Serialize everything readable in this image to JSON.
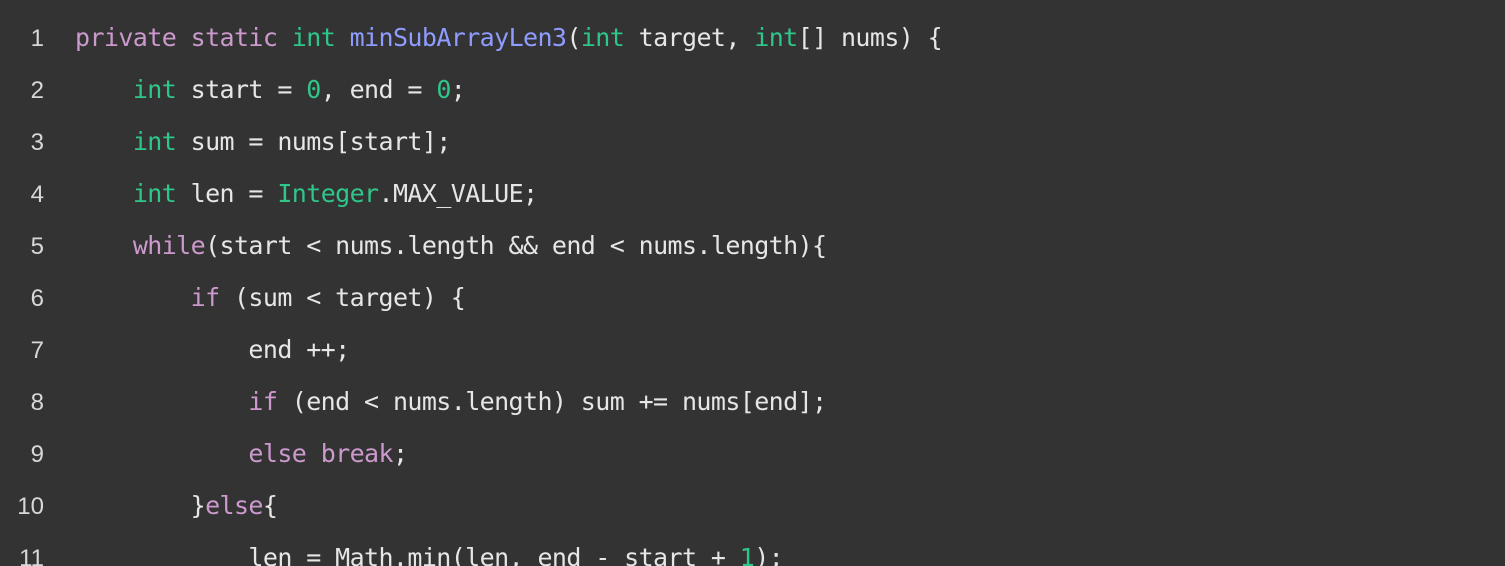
{
  "editor": {
    "lines": [
      {
        "number": "1",
        "tokens": [
          {
            "t": "private",
            "k": "kw-purple"
          },
          {
            "t": " ",
            "k": "plain"
          },
          {
            "t": "static",
            "k": "kw-purple"
          },
          {
            "t": " ",
            "k": "plain"
          },
          {
            "t": "int",
            "k": "kw-green"
          },
          {
            "t": " ",
            "k": "plain"
          },
          {
            "t": "minSubArrayLen3",
            "k": "fn-blue"
          },
          {
            "t": "(",
            "k": "plain"
          },
          {
            "t": "int",
            "k": "kw-green"
          },
          {
            "t": " target, ",
            "k": "plain"
          },
          {
            "t": "int",
            "k": "kw-green"
          },
          {
            "t": "[] nums) {",
            "k": "plain"
          }
        ]
      },
      {
        "number": "2",
        "tokens": [
          {
            "t": "    ",
            "k": "plain"
          },
          {
            "t": "int",
            "k": "kw-green"
          },
          {
            "t": " start = ",
            "k": "plain"
          },
          {
            "t": "0",
            "k": "num-green"
          },
          {
            "t": ", end = ",
            "k": "plain"
          },
          {
            "t": "0",
            "k": "num-green"
          },
          {
            "t": ";",
            "k": "plain"
          }
        ]
      },
      {
        "number": "3",
        "tokens": [
          {
            "t": "    ",
            "k": "plain"
          },
          {
            "t": "int",
            "k": "kw-green"
          },
          {
            "t": " sum = nums[start];",
            "k": "plain"
          }
        ]
      },
      {
        "number": "4",
        "tokens": [
          {
            "t": "    ",
            "k": "plain"
          },
          {
            "t": "int",
            "k": "kw-green"
          },
          {
            "t": " len = ",
            "k": "plain"
          },
          {
            "t": "Integer",
            "k": "type-green"
          },
          {
            "t": ".MAX_VALUE;",
            "k": "plain"
          }
        ]
      },
      {
        "number": "5",
        "tokens": [
          {
            "t": "    ",
            "k": "plain"
          },
          {
            "t": "while",
            "k": "kw-purple"
          },
          {
            "t": "(start < nums.length && end < nums.length){",
            "k": "plain"
          }
        ]
      },
      {
        "number": "6",
        "tokens": [
          {
            "t": "        ",
            "k": "plain"
          },
          {
            "t": "if",
            "k": "kw-purple"
          },
          {
            "t": " (sum < target) {",
            "k": "plain"
          }
        ]
      },
      {
        "number": "7",
        "tokens": [
          {
            "t": "            end ++;",
            "k": "plain"
          }
        ]
      },
      {
        "number": "8",
        "tokens": [
          {
            "t": "            ",
            "k": "plain"
          },
          {
            "t": "if",
            "k": "kw-purple"
          },
          {
            "t": " (end < nums.length) sum += nums[end];",
            "k": "plain"
          }
        ]
      },
      {
        "number": "9",
        "tokens": [
          {
            "t": "            ",
            "k": "plain"
          },
          {
            "t": "else",
            "k": "kw-purple"
          },
          {
            "t": " ",
            "k": "plain"
          },
          {
            "t": "break",
            "k": "kw-purple"
          },
          {
            "t": ";",
            "k": "plain"
          }
        ]
      },
      {
        "number": "10",
        "tokens": [
          {
            "t": "        }",
            "k": "plain"
          },
          {
            "t": "else",
            "k": "kw-purple"
          },
          {
            "t": "{",
            "k": "plain"
          }
        ]
      },
      {
        "number": "11",
        "tokens": [
          {
            "t": "            len = Math.min(len, end - start + ",
            "k": "plain"
          },
          {
            "t": "1",
            "k": "num-green"
          },
          {
            "t": ");",
            "k": "plain"
          }
        ]
      }
    ]
  },
  "colors": {
    "background": "#333333",
    "keyword_purple": "#cc99cd",
    "keyword_green": "#2fc68a",
    "function_blue": "#8f9cff",
    "text": "#e6e6e6"
  }
}
